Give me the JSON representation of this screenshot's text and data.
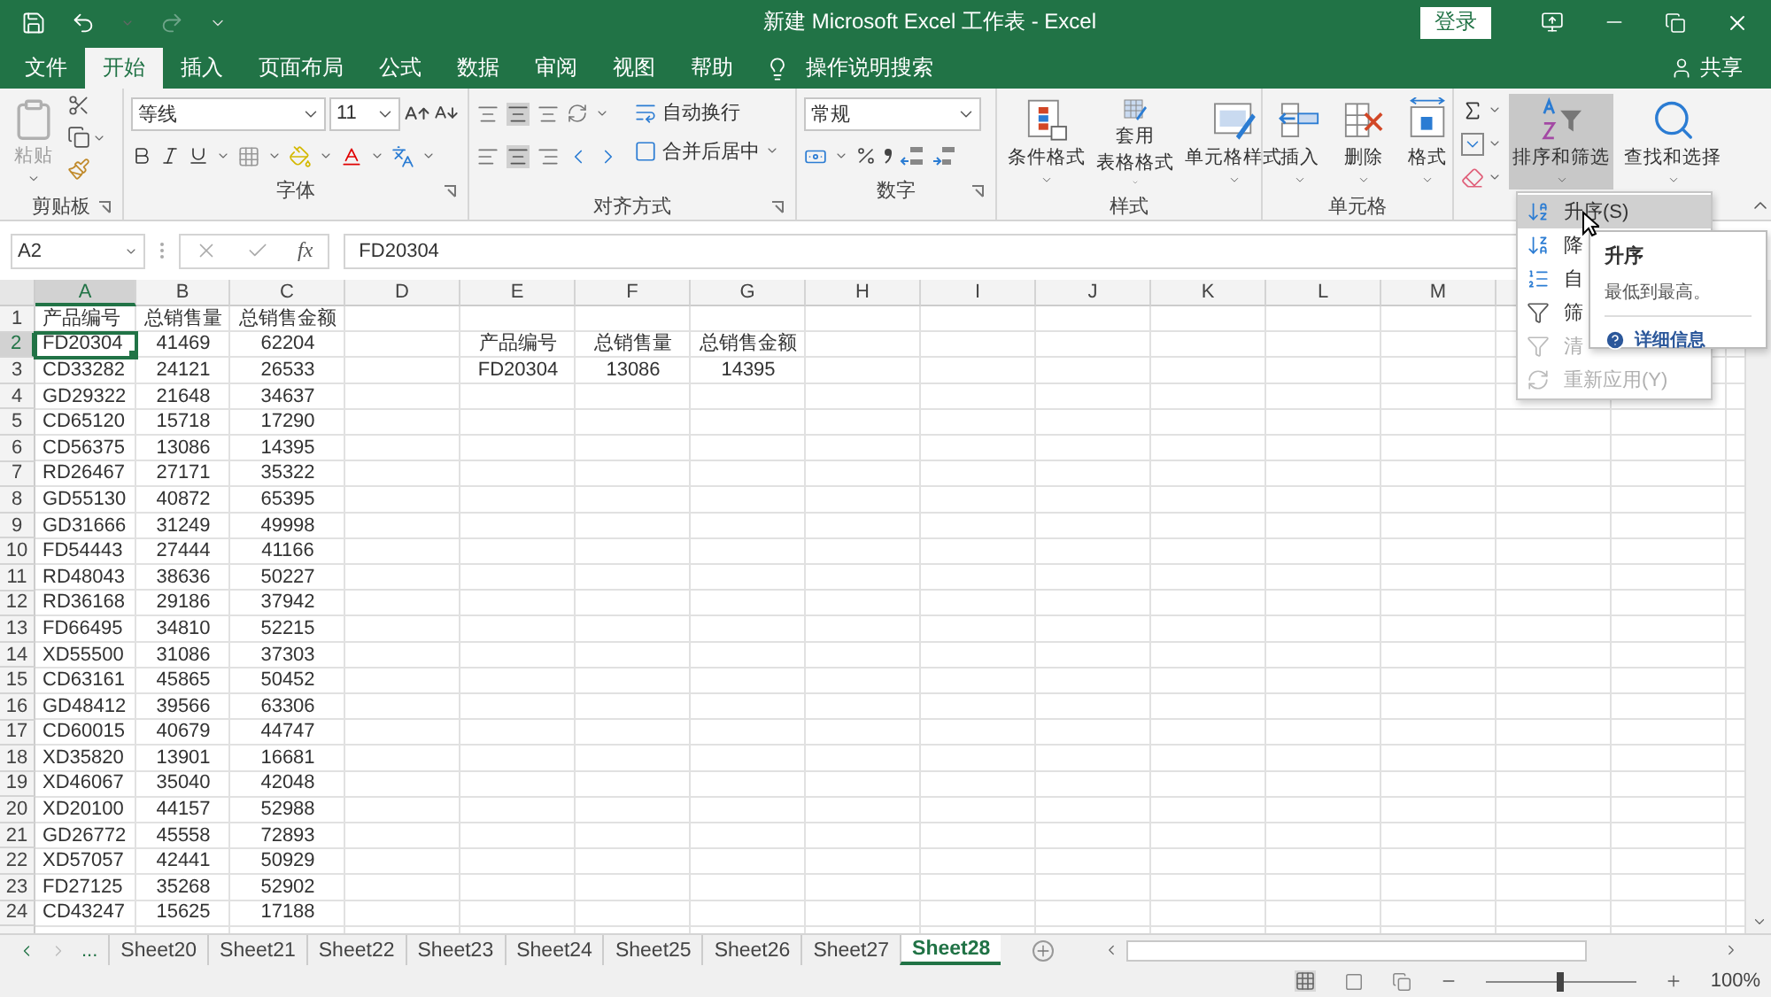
{
  "title_bar": {
    "title": "新建 Microsoft Excel 工作表  -  Excel",
    "login": "登录"
  },
  "ribbon_tabs": [
    {
      "label": "文件",
      "selected": false
    },
    {
      "label": "开始",
      "selected": true
    },
    {
      "label": "插入",
      "selected": false
    },
    {
      "label": "页面布局",
      "selected": false
    },
    {
      "label": "公式",
      "selected": false
    },
    {
      "label": "数据",
      "selected": false
    },
    {
      "label": "审阅",
      "selected": false
    },
    {
      "label": "视图",
      "selected": false
    },
    {
      "label": "帮助",
      "selected": false
    }
  ],
  "tell_me": "操作说明搜索",
  "share": "共享",
  "clipboard": {
    "label": "剪贴板",
    "paste": "粘贴"
  },
  "font": {
    "label": "字体",
    "font_name": "等线",
    "font_size": "11"
  },
  "alignment": {
    "label": "对齐方式",
    "wrap_text": "自动换行",
    "merge_center": "合并后居中"
  },
  "number": {
    "label": "数字",
    "format": "常规"
  },
  "styles": {
    "label": "样式",
    "buttons": [
      {
        "kind": "conditional",
        "lines": [
          "条件格式"
        ]
      },
      {
        "kind": "table",
        "lines": [
          "套用",
          "表格格式"
        ]
      },
      {
        "kind": "cell",
        "lines": [
          "单元格样式"
        ]
      }
    ]
  },
  "cells": {
    "label": "单元格",
    "buttons": [
      {
        "kind": "insert",
        "label": "插入"
      },
      {
        "kind": "delete",
        "label": "删除"
      },
      {
        "kind": "format",
        "label": "格式"
      }
    ]
  },
  "editing": {
    "buttons": [
      {
        "kind": "sort",
        "label": "排序和筛选",
        "pressed": true
      },
      {
        "kind": "find",
        "label": "查找和选择",
        "pressed": false
      }
    ]
  },
  "formula_bar": {
    "name_box": "A2",
    "function_label": "fx",
    "formula": "FD20304"
  },
  "columns": [
    "A",
    "B",
    "C",
    "D",
    "E",
    "F",
    "G",
    "H",
    "I",
    "J",
    "K",
    "L",
    "M"
  ],
  "row_numbers": [
    "1",
    "2",
    "3",
    "4",
    "5",
    "6",
    "7",
    "8",
    "9",
    "10",
    "11",
    "12",
    "13",
    "14",
    "15",
    "16",
    "17",
    "18",
    "19",
    "20",
    "21",
    "22",
    "23",
    "24"
  ],
  "main_table": [
    {
      "cells": [
        "产品编号",
        "总销售量",
        "总销售金额"
      ],
      "selected": false
    },
    {
      "cells": [
        "FD20304",
        "41469",
        "62204"
      ],
      "selected": true
    },
    {
      "cells": [
        "CD33282",
        "24121",
        "26533"
      ],
      "selected": false
    },
    {
      "cells": [
        "GD29322",
        "21648",
        "34637"
      ],
      "selected": false
    },
    {
      "cells": [
        "CD65120",
        "15718",
        "17290"
      ],
      "selected": false
    },
    {
      "cells": [
        "CD56375",
        "13086",
        "14395"
      ],
      "selected": false
    },
    {
      "cells": [
        "RD26467",
        "27171",
        "35322"
      ],
      "selected": false
    },
    {
      "cells": [
        "GD55130",
        "40872",
        "65395"
      ],
      "selected": false
    },
    {
      "cells": [
        "GD31666",
        "31249",
        "49998"
      ],
      "selected": false
    },
    {
      "cells": [
        "FD54443",
        "27444",
        "41166"
      ],
      "selected": false
    },
    {
      "cells": [
        "RD48043",
        "38636",
        "50227"
      ],
      "selected": false
    },
    {
      "cells": [
        "RD36168",
        "29186",
        "37942"
      ],
      "selected": false
    },
    {
      "cells": [
        "FD66495",
        "34810",
        "52215"
      ],
      "selected": false
    },
    {
      "cells": [
        "XD55500",
        "31086",
        "37303"
      ],
      "selected": false
    },
    {
      "cells": [
        "CD63161",
        "45865",
        "50452"
      ],
      "selected": false
    },
    {
      "cells": [
        "GD48412",
        "39566",
        "63306"
      ],
      "selected": false
    },
    {
      "cells": [
        "CD60015",
        "40679",
        "44747"
      ],
      "selected": false
    },
    {
      "cells": [
        "XD35820",
        "13901",
        "16681"
      ],
      "selected": false
    },
    {
      "cells": [
        "XD46067",
        "35040",
        "42048"
      ],
      "selected": false
    },
    {
      "cells": [
        "XD20100",
        "44157",
        "52988"
      ],
      "selected": false
    },
    {
      "cells": [
        "GD26772",
        "45558",
        "72893"
      ],
      "selected": false
    },
    {
      "cells": [
        "XD57057",
        "42441",
        "50929"
      ],
      "selected": false
    },
    {
      "cells": [
        "FD27125",
        "35268",
        "52902"
      ],
      "selected": false
    },
    {
      "cells": [
        "CD43247",
        "15625",
        "17188"
      ],
      "selected": false
    }
  ],
  "lookup_table": [
    {
      "cells": [
        "产品编号",
        "总销售量",
        "总销售金额"
      ]
    },
    {
      "cells": [
        "FD20304",
        "13086",
        "14395"
      ]
    }
  ],
  "sheet_tabs": {
    "overflow": "...",
    "tabs": [
      {
        "label": "Sheet20",
        "selected": false
      },
      {
        "label": "Sheet21",
        "selected": false
      },
      {
        "label": "Sheet22",
        "selected": false
      },
      {
        "label": "Sheet23",
        "selected": false
      },
      {
        "label": "Sheet24",
        "selected": false
      },
      {
        "label": "Sheet25",
        "selected": false
      },
      {
        "label": "Sheet26",
        "selected": false
      },
      {
        "label": "Sheet27",
        "selected": false
      },
      {
        "label": "Sheet28",
        "selected": true
      }
    ]
  },
  "status_bar": {
    "zoom": "100%",
    "zoom_slider": {
      "level": 0.5
    }
  },
  "sort_menu": [
    {
      "kind": "sort-asc",
      "label": "升序(S)",
      "highlighted": true,
      "disabled": false
    },
    {
      "kind": "sort-desc",
      "label": "降",
      "highlighted": false,
      "disabled": false
    },
    {
      "kind": "custom",
      "label": "自",
      "highlighted": false,
      "disabled": false
    },
    {
      "kind": "filter",
      "label": "筛",
      "highlighted": false,
      "disabled": false
    },
    {
      "kind": "clear",
      "label": "清",
      "highlighted": false,
      "disabled": true
    },
    {
      "kind": "reapply",
      "label": "重新应用(Y)",
      "highlighted": false,
      "disabled": true
    }
  ],
  "tooltip": {
    "title": "升序",
    "body": "最低到最高。",
    "link": "详细信息"
  }
}
